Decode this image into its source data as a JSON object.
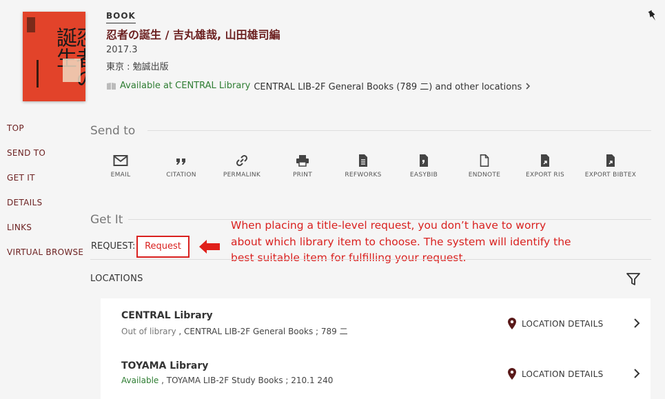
{
  "record": {
    "type": "BOOK",
    "title": "忍者の誕生 / 吉丸雄哉, 山田雄司編",
    "date": "2017.3",
    "publisher": "東京 : 勉誠出版",
    "availability_status": "Available at CENTRAL Library",
    "availability_location": "CENTRAL LIB-2F General Books (789 二) and other locations"
  },
  "cover": {
    "title_text": "忍者の誕生"
  },
  "sidenav": [
    "TOP",
    "SEND TO",
    "GET IT",
    "DETAILS",
    "LINKS",
    "VIRTUAL BROWSE"
  ],
  "send_to": {
    "title": "Send to",
    "items": [
      {
        "label": "EMAIL",
        "icon": "email-icon"
      },
      {
        "label": "CITATION",
        "icon": "quote-icon"
      },
      {
        "label": "PERMALINK",
        "icon": "link-icon"
      },
      {
        "label": "PRINT",
        "icon": "printer-icon"
      },
      {
        "label": "REFWORKS",
        "icon": "document-icon"
      },
      {
        "label": "EASYBIB",
        "icon": "easybib-icon"
      },
      {
        "label": "ENDNOTE",
        "icon": "file-icon"
      },
      {
        "label": "EXPORT RIS",
        "icon": "export-icon"
      },
      {
        "label": "EXPORT BIBTEX",
        "icon": "export-icon"
      }
    ]
  },
  "get_it": {
    "title": "Get It",
    "request_label": "REQUEST:",
    "request_button": "Request",
    "annotation": "When placing a title-level request, you don’t have to worry about which library item to choose. The system will identify the best suitable item for fulfilling your request."
  },
  "locations": {
    "header": "LOCATIONS",
    "detail_label": "LOCATION DETAILS",
    "items": [
      {
        "name": "CENTRAL Library",
        "status": "Out of library",
        "info": " , CENTRAL LIB-2F General Books ; 789 二"
      },
      {
        "name": "TOYAMA Library",
        "status": "Available",
        "info": " , TOYAMA LIB-2F Study Books ; 210.1 240"
      }
    ]
  },
  "colors": {
    "brand": "#6b1f1f",
    "available": "#2e7d32",
    "annotation": "#d9211f"
  }
}
